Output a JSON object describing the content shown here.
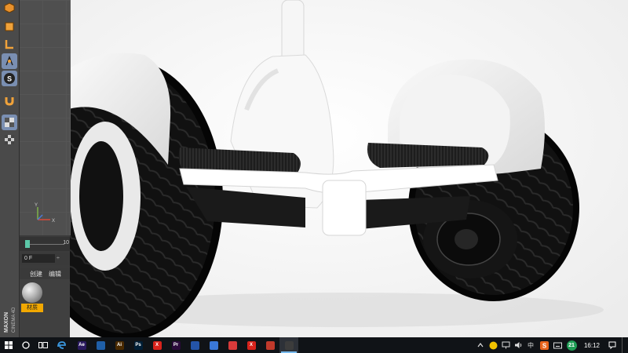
{
  "cinema4d": {
    "brand": "MAXON CINEMA 4D",
    "timeline": {
      "end_label": "10",
      "progress": 0.0
    },
    "frame_field": "0 F",
    "frame_step": "÷",
    "material_tabs": [
      "创建",
      "编辑"
    ],
    "material_name": "材质",
    "toolbar_icons": [
      "cube-icon",
      "l-shape-icon",
      "workplane-icon",
      "snap-s-icon",
      "magnet-icon",
      "lock-grid-icon",
      "checker-grid-icon"
    ],
    "axis_labels": {
      "y": "Y",
      "x": "X"
    }
  },
  "taskbar": {
    "apps": [
      {
        "name": "After Effects",
        "short": "Ae",
        "color": "#2a1a5e"
      },
      {
        "name": "Photos",
        "short": "",
        "color": "#1f5fa8"
      },
      {
        "name": "Illustrator",
        "short": "Ai",
        "color": "#4a2a00"
      },
      {
        "name": "Photoshop",
        "short": "Ps",
        "color": "#001e36"
      },
      {
        "name": "XMind",
        "short": "X",
        "color": "#d8231c"
      },
      {
        "name": "Premiere",
        "short": "Pr",
        "color": "#2a0a3a"
      },
      {
        "name": "Cinema 4D",
        "short": "",
        "color": "#2454a8"
      },
      {
        "name": "Browser",
        "short": "",
        "color": "#3a78d8"
      },
      {
        "name": "Recorder",
        "short": "",
        "color": "#d83a3a"
      },
      {
        "name": "XMind",
        "short": "X",
        "color": "#d8231c"
      },
      {
        "name": "Snipping",
        "short": "",
        "color": "#c0392b"
      },
      {
        "name": "Image Viewer",
        "short": "",
        "color": "#3c3c3c"
      }
    ],
    "tray": {
      "ime_lang": "中",
      "notification_count": "21",
      "time": "16:12",
      "accent": "#76b9ed"
    }
  }
}
